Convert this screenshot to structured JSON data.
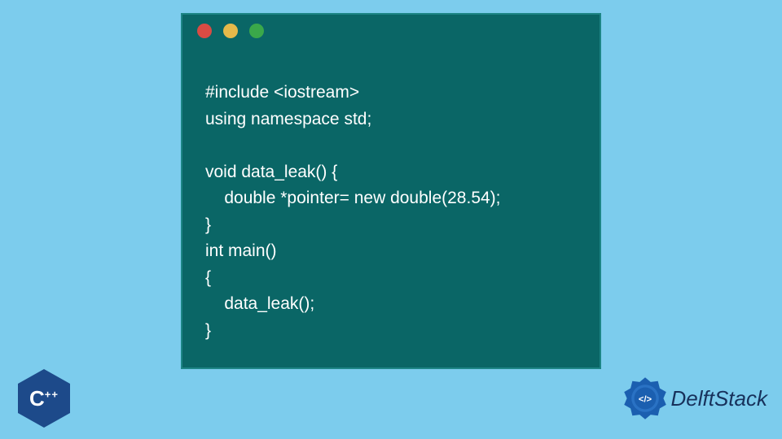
{
  "code": {
    "lines": [
      "#include <iostream>",
      "using namespace std;",
      "",
      "void data_leak() {",
      "    double *pointer= new double(28.54);",
      "}",
      "int main()",
      "{",
      "    data_leak();",
      "}"
    ]
  },
  "cpp_badge": {
    "letter": "C",
    "suffix": "++"
  },
  "brand": {
    "name": "DelftStack"
  }
}
